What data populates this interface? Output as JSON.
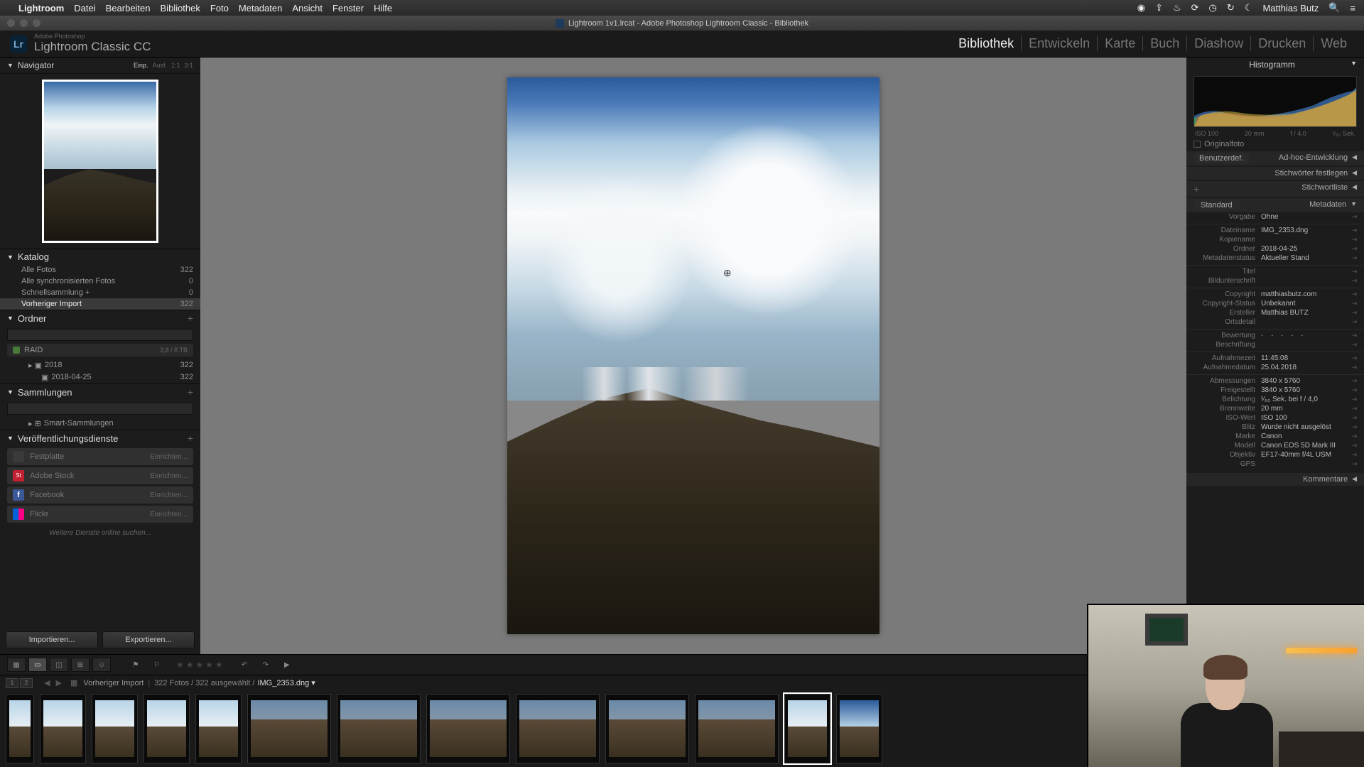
{
  "mac_menu": {
    "app": "Lightroom",
    "items": [
      "Datei",
      "Bearbeiten",
      "Bibliothek",
      "Foto",
      "Metadaten",
      "Ansicht",
      "Fenster",
      "Hilfe"
    ],
    "user": "Matthias Butz"
  },
  "window_title": "Lightroom 1v1.lrcat - Adobe Photoshop Lightroom Classic - Bibliothek",
  "identity": {
    "product_top": "Adobe Photoshop",
    "product": "Lightroom Classic CC",
    "modules": [
      "Bibliothek",
      "Entwickeln",
      "Karte",
      "Buch",
      "Diashow",
      "Drucken",
      "Web"
    ],
    "active_module": "Bibliothek"
  },
  "left": {
    "navigator": {
      "title": "Navigator",
      "opts": [
        "Einp.",
        "Ausf.",
        "1:1",
        "3:1"
      ]
    },
    "catalog": {
      "title": "Katalog",
      "rows": [
        {
          "label": "Alle Fotos",
          "count": "322"
        },
        {
          "label": "Alle synchronisierten Fotos",
          "count": "0"
        },
        {
          "label": "Schnellsammlung  +",
          "count": "0"
        },
        {
          "label": "Vorheriger Import",
          "count": "322",
          "selected": true
        }
      ]
    },
    "folders": {
      "title": "Ordner",
      "volume": {
        "name": "RAID",
        "stat": "3,8 / 8 TB"
      },
      "tree": [
        {
          "label": "2018",
          "count": "322",
          "indent": 0
        },
        {
          "label": "2018-04-25",
          "count": "322",
          "indent": 1
        }
      ]
    },
    "collections": {
      "title": "Sammlungen",
      "smart": "Smart-Sammlungen"
    },
    "publish": {
      "title": "Veröffentlichungsdienste",
      "services": [
        {
          "name": "Festplatte",
          "color": "#3a3a3a"
        },
        {
          "name": "Adobe Stock",
          "color": "#c02030"
        },
        {
          "name": "Facebook",
          "color": "#3b5998"
        },
        {
          "name": "Flickr",
          "color": "#ff0084"
        }
      ],
      "setup": "Einrichten...",
      "more": "Weitere Dienste online suchen..."
    },
    "buttons": {
      "import": "Importieren...",
      "export": "Exportieren..."
    }
  },
  "right": {
    "histogram": {
      "title": "Histogramm",
      "iso": "ISO 100",
      "focal": "20 mm",
      "aperture": "f / 4,0",
      "exposure": "¹⁄₆₀ Sek."
    },
    "original": "Originalfoto",
    "quickdev": {
      "preset_label": "Benutzerdef.",
      "title": "Ad-hoc-Entwicklung"
    },
    "keywording": "Stichwörter festlegen",
    "keywordlist": "Stichwortliste",
    "metadata": {
      "title": "Metadaten",
      "preset": "Standard",
      "rows": [
        {
          "k": "Vorgabe",
          "v": "Ohne"
        },
        {
          "k": "Dateiname",
          "v": "IMG_2353.dng"
        },
        {
          "k": "Kopiename",
          "v": ""
        },
        {
          "k": "Ordner",
          "v": "2018-04-25"
        },
        {
          "k": "Metadatenstatus",
          "v": "Aktueller Stand"
        },
        {
          "k": "Titel",
          "v": ""
        },
        {
          "k": "Bildunterschrift",
          "v": ""
        },
        {
          "k": "Copyright",
          "v": "matthiasbutz.com"
        },
        {
          "k": "Copyright-Status",
          "v": "Unbekannt"
        },
        {
          "k": "Ersteller",
          "v": "Matthias BUTZ"
        },
        {
          "k": "Ortsdetail",
          "v": ""
        },
        {
          "k": "Bewertung",
          "v": "·  ·  ·  ·  ·"
        },
        {
          "k": "Beschriftung",
          "v": ""
        },
        {
          "k": "Aufnahmezeit",
          "v": "11:45:08"
        },
        {
          "k": "Aufnahmedatum",
          "v": "25.04.2018"
        },
        {
          "k": "Abmessungen",
          "v": "3840 x 5760"
        },
        {
          "k": "Freigestellt",
          "v": "3840 x 5760"
        },
        {
          "k": "Belichtung",
          "v": "¹⁄₆₀ Sek. bei f / 4,0"
        },
        {
          "k": "Brennweite",
          "v": "20 mm"
        },
        {
          "k": "ISO-Wert",
          "v": "ISO 100"
        },
        {
          "k": "Blitz",
          "v": "Wurde nicht ausgelöst"
        },
        {
          "k": "Marke",
          "v": "Canon"
        },
        {
          "k": "Modell",
          "v": "Canon EOS 5D Mark III"
        },
        {
          "k": "Objektiv",
          "v": "EF17-40mm f/4L USM"
        },
        {
          "k": "GPS",
          "v": ""
        }
      ]
    },
    "comments": "Kommentare"
  },
  "filmstrip": {
    "source": "Vorheriger Import",
    "info": "322 Fotos / 322 ausgewählt /",
    "filename": "IMG_2353.dng ▾"
  }
}
